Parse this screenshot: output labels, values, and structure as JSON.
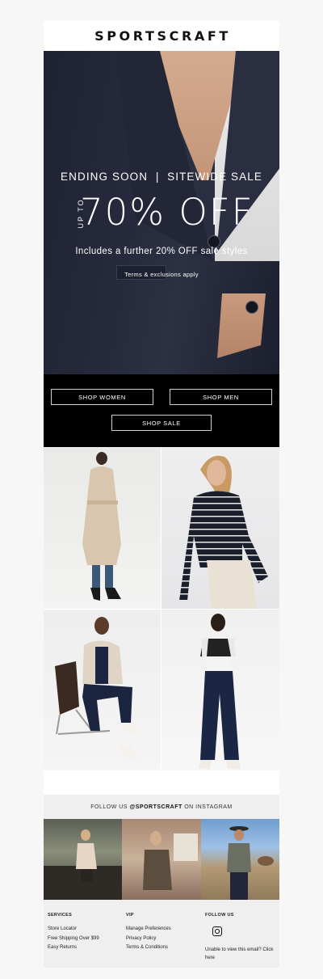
{
  "brand": {
    "name": "SPORTSCRAFT"
  },
  "hero": {
    "headline": "ENDING SOON  |  SITEWIDE SALE",
    "up_to": "UP TO",
    "discount": "70% OFF",
    "subline": "Includes a further 20% OFF sale styles",
    "terms": "Terms & exclusions apply"
  },
  "cta": {
    "shop_women": "SHOP WOMEN",
    "shop_men": "SHOP MEN",
    "shop_sale": "SHOP SALE"
  },
  "instagram": {
    "follow_prefix": "FOLLOW US ",
    "handle": "@SPORTSCRAFT",
    "follow_suffix": " ON INSTAGRAM"
  },
  "footer": {
    "services": {
      "heading": "SERVICES",
      "links": [
        "Store Locator",
        "Free Shipping Over $99",
        "Easy Returns"
      ]
    },
    "vip": {
      "heading": "VIP",
      "links": [
        "Manage Preferences",
        "Privacy Policy",
        "Terms & Conditions"
      ]
    },
    "follow": {
      "heading": "FOLLOW US",
      "icon": "instagram-icon",
      "unable": "Unable to view this email? Click here"
    }
  },
  "colors": {
    "hero_bg": "#262a3c",
    "cta_bg": "#000000",
    "footer_bg": "#efefef"
  }
}
